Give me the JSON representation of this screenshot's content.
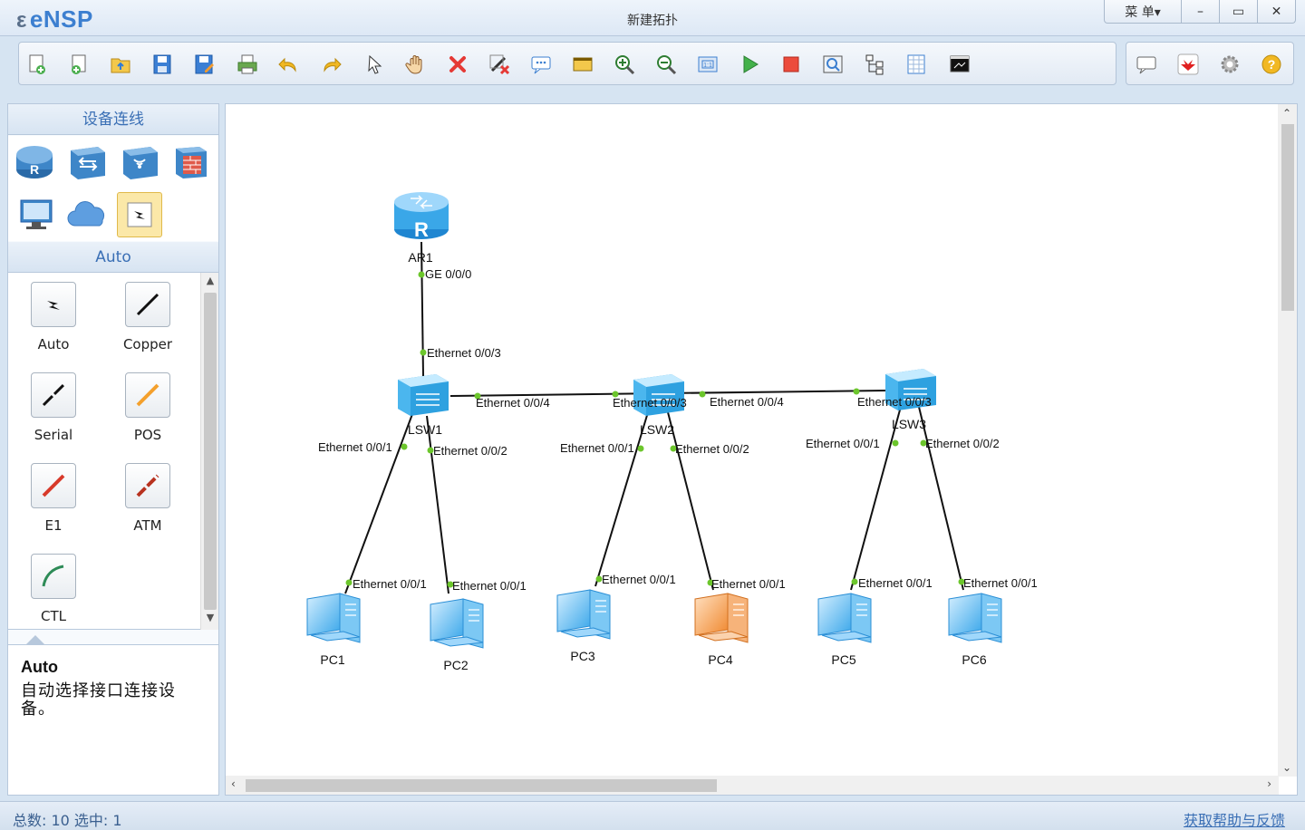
{
  "app": {
    "logo": "eNSP",
    "title": "新建拓扑"
  },
  "window_controls": {
    "menu": "菜 单▾",
    "minimize": "–",
    "maximize": "▭",
    "close": "✕"
  },
  "toolbar": {
    "buttons": [
      "new-topology",
      "new-example",
      "open",
      "save",
      "save-as",
      "print",
      "undo",
      "redo",
      "select",
      "pan",
      "delete",
      "delete-link",
      "text",
      "palette",
      "zoom-in",
      "zoom-out",
      "fit",
      "start-device",
      "stop-device",
      "capture",
      "topology",
      "grid",
      "console"
    ],
    "right_buttons": [
      "chat",
      "huawei",
      "settings",
      "help"
    ]
  },
  "left_panel": {
    "devices_header": "设备连线",
    "devices": [
      "router",
      "switch",
      "wlan",
      "firewall",
      "pc",
      "cloud",
      "auto-cable"
    ],
    "category_label": "Auto",
    "cables": [
      {
        "label": "Auto",
        "icon": "bolt-icon"
      },
      {
        "label": "Copper",
        "icon": "copper-cable-icon"
      },
      {
        "label": "Serial",
        "icon": "serial-cable-icon"
      },
      {
        "label": "POS",
        "icon": "pos-cable-icon"
      },
      {
        "label": "E1",
        "icon": "e1-cable-icon"
      },
      {
        "label": "ATM",
        "icon": "atm-cable-icon"
      },
      {
        "label": "CTL",
        "icon": "ctl-cable-icon"
      }
    ],
    "description": {
      "title": "Auto",
      "text": "自动选择接口连接设备。"
    }
  },
  "topology": {
    "devices": {
      "ar1": "AR1",
      "lsw1": "LSW1",
      "lsw2": "LSW2",
      "lsw3": "LSW3",
      "pc1": "PC1",
      "pc2": "PC2",
      "pc3": "PC3",
      "pc4": "PC4",
      "pc5": "PC5",
      "pc6": "PC6"
    },
    "interfaces": {
      "ar1_ge": "GE 0/0/0",
      "lsw1_e3": "Ethernet 0/0/3",
      "lsw1_e4": "Ethernet 0/0/4",
      "lsw1_e1": "Ethernet 0/0/1",
      "lsw1_e2": "Ethernet 0/0/2",
      "lsw2_e3": "Ethernet 0/0/3",
      "lsw2_e4": "Ethernet 0/0/4",
      "lsw2_e1": "Ethernet 0/0/1",
      "lsw2_e2": "Ethernet 0/0/2",
      "lsw3_e3": "Ethernet 0/0/3",
      "lsw3_e1": "Ethernet 0/0/1",
      "lsw3_e2": "Ethernet 0/0/2",
      "pc1_e1": "Ethernet 0/0/1",
      "pc2_e1": "Ethernet 0/0/1",
      "pc3_e1": "Ethernet 0/0/1",
      "pc4_e1": "Ethernet 0/0/1",
      "pc5_e1": "Ethernet 0/0/1",
      "pc6_e1": "Ethernet 0/0/1"
    },
    "colors": {
      "link": "#111111",
      "port_dot": "#6cc62c",
      "router": "#3aa7e8",
      "switch": "#5ec0ee",
      "pc": "#4fb3ee",
      "pc_selected": "#f39a4c"
    }
  },
  "status": {
    "left": "总数: 10  选中: 1",
    "right": "获取帮助与反馈"
  }
}
